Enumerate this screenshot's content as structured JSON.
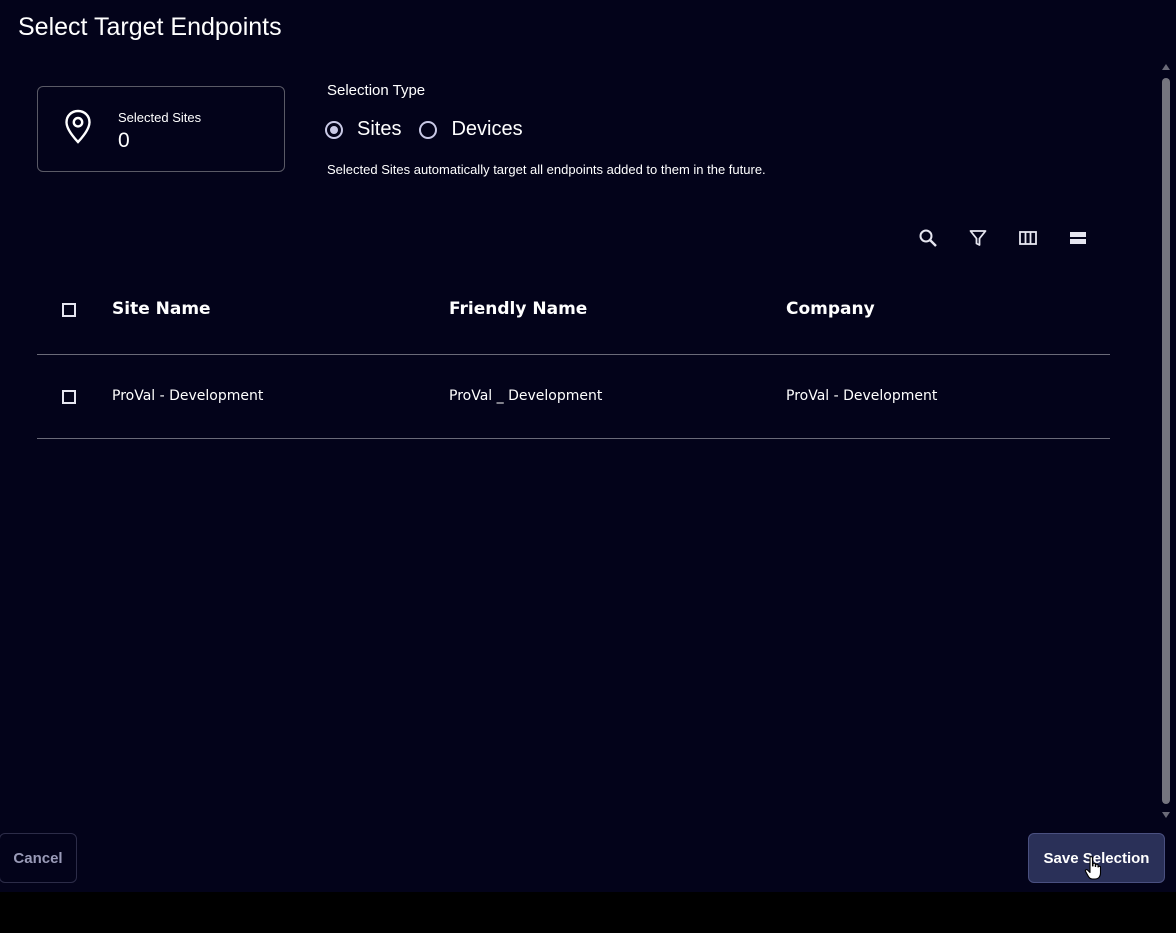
{
  "dialog": {
    "title": "Select Target Endpoints"
  },
  "selected_card": {
    "label": "Selected Sites",
    "value": "0",
    "icon": "map-pin-icon"
  },
  "selection_type": {
    "label": "Selection Type",
    "options": [
      {
        "label": "Sites",
        "checked": true
      },
      {
        "label": "Devices",
        "checked": false
      }
    ],
    "helper": "Selected Sites automatically target all endpoints added to them in the future."
  },
  "toolbar": {
    "icons": [
      "search-icon",
      "filter-icon",
      "columns-icon",
      "density-icon"
    ]
  },
  "table": {
    "columns": [
      "Site Name",
      "Friendly Name",
      "Company"
    ],
    "rows": [
      {
        "site_name": "ProVal - Development",
        "friendly_name": "ProVal _ Development",
        "company": "ProVal - Development"
      }
    ]
  },
  "footer": {
    "cancel_label": "Cancel",
    "save_label": "Save Selection"
  },
  "colors": {
    "background": "#03031a",
    "accent": "#2a3058",
    "border": "#6a6a78"
  }
}
